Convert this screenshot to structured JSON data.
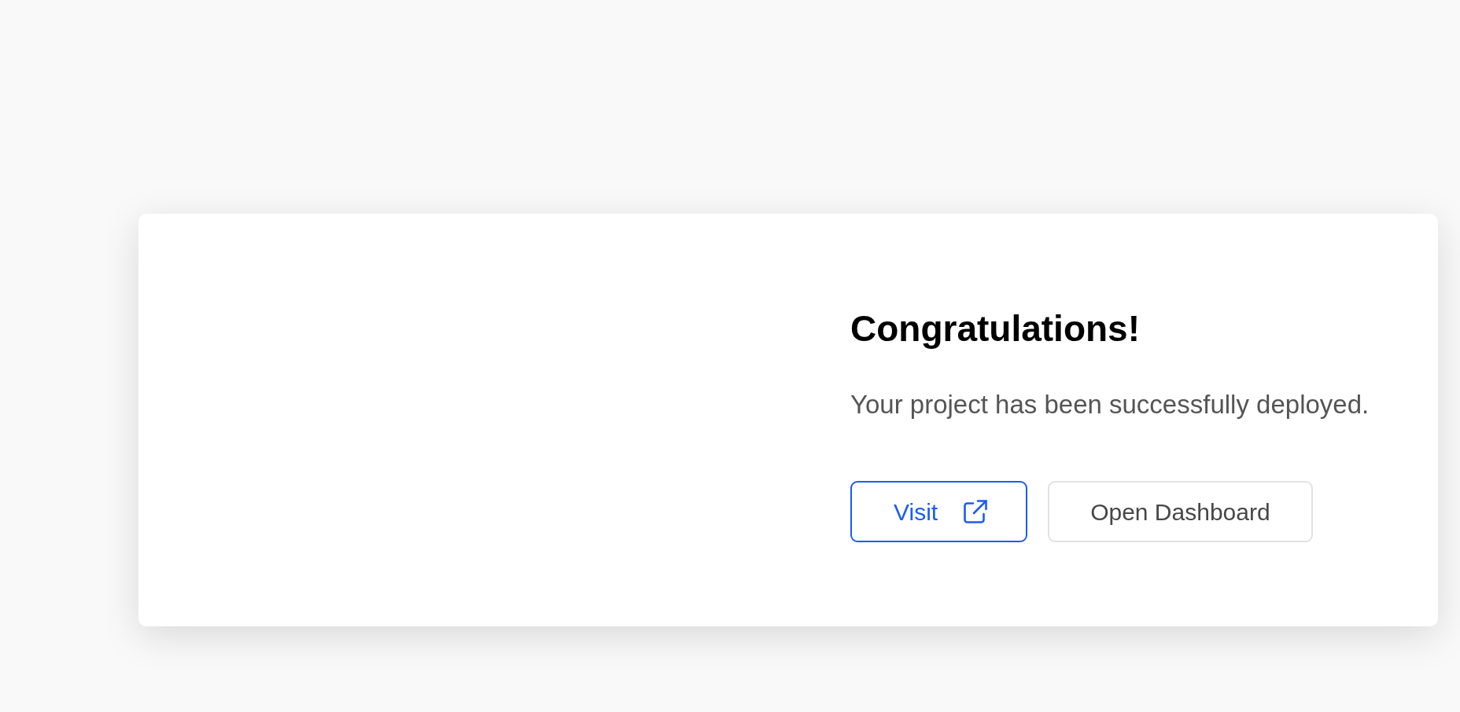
{
  "card": {
    "title": "Congratulations!",
    "message": "Your project has been successfully deployed.",
    "buttons": [
      {
        "label": "Visit",
        "kind": "primary"
      },
      {
        "label": "Open Dashboard",
        "kind": "secondary"
      }
    ]
  }
}
